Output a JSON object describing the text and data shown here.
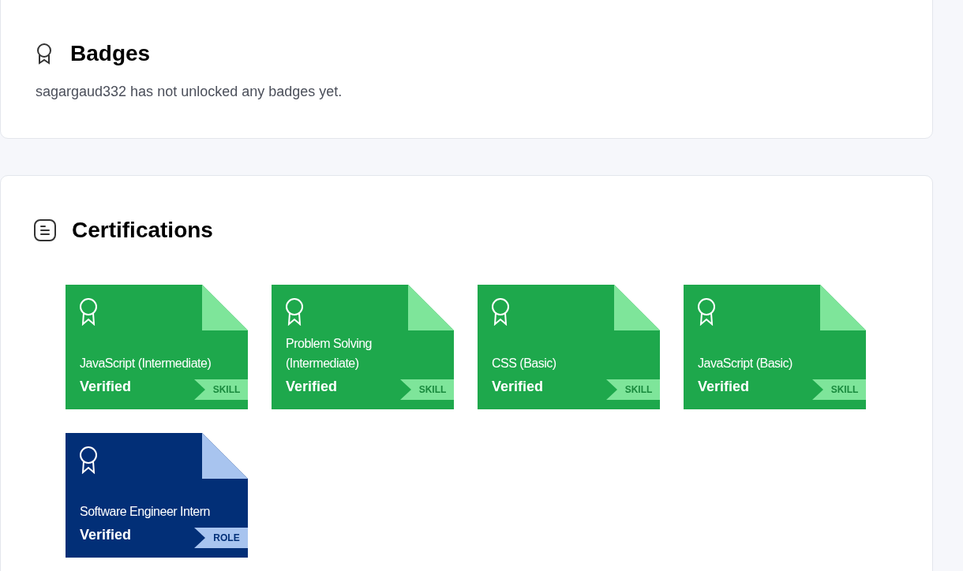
{
  "badges": {
    "title": "Badges",
    "message": "sagargaud332 has not unlocked any badges yet."
  },
  "certifications": {
    "title": "Certifications",
    "items": [
      {
        "kind": "skill",
        "name": "JavaScript (Intermediate)",
        "status": "Verified",
        "tag": "SKILL"
      },
      {
        "kind": "skill",
        "name": "Problem Solving (Intermediate)",
        "status": "Verified",
        "tag": "SKILL"
      },
      {
        "kind": "skill",
        "name": "CSS (Basic)",
        "status": "Verified",
        "tag": "SKILL"
      },
      {
        "kind": "skill",
        "name": "JavaScript (Basic)",
        "status": "Verified",
        "tag": "SKILL"
      },
      {
        "kind": "role",
        "name": "Software Engineer Intern",
        "status": "Verified",
        "tag": "ROLE"
      }
    ]
  }
}
